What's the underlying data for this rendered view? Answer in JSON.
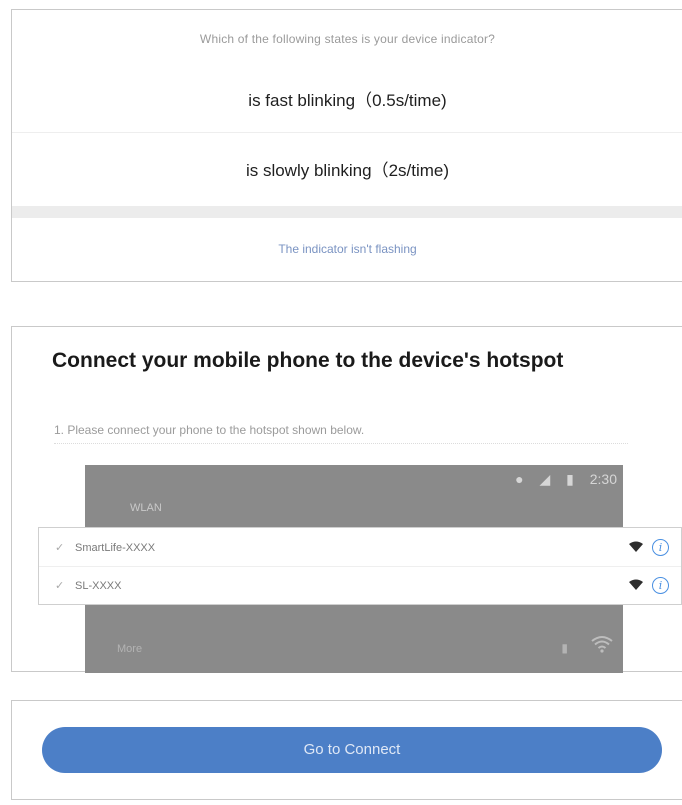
{
  "indicator_dialog": {
    "question": "Which of the following states is your device indicator?",
    "options": [
      "is fast blinking（0.5s/time)",
      "is slowly blinking（2s/time)"
    ],
    "bottom_link": "The indicator isn't flashing"
  },
  "hotspot": {
    "title": "Connect your mobile phone to the device's hotspot",
    "step": "1. Please connect your phone to the hotspot shown below.",
    "phone": {
      "time": "2:30",
      "wlan_label": "WLAN",
      "bottom_label": "More"
    },
    "networks": [
      {
        "name": "SmartLife-XXXX",
        "signal_icon": "wifi-signal-icon",
        "info_icon": "info-icon"
      },
      {
        "name": "SL-XXXX",
        "signal_icon": "wifi-signal-icon",
        "info_icon": "info-icon"
      }
    ]
  },
  "footer": {
    "button_label": "Go to Connect"
  },
  "colors": {
    "accent": "#4c7fc7",
    "info_blue": "#4a90e2",
    "separator": "#ececec"
  }
}
